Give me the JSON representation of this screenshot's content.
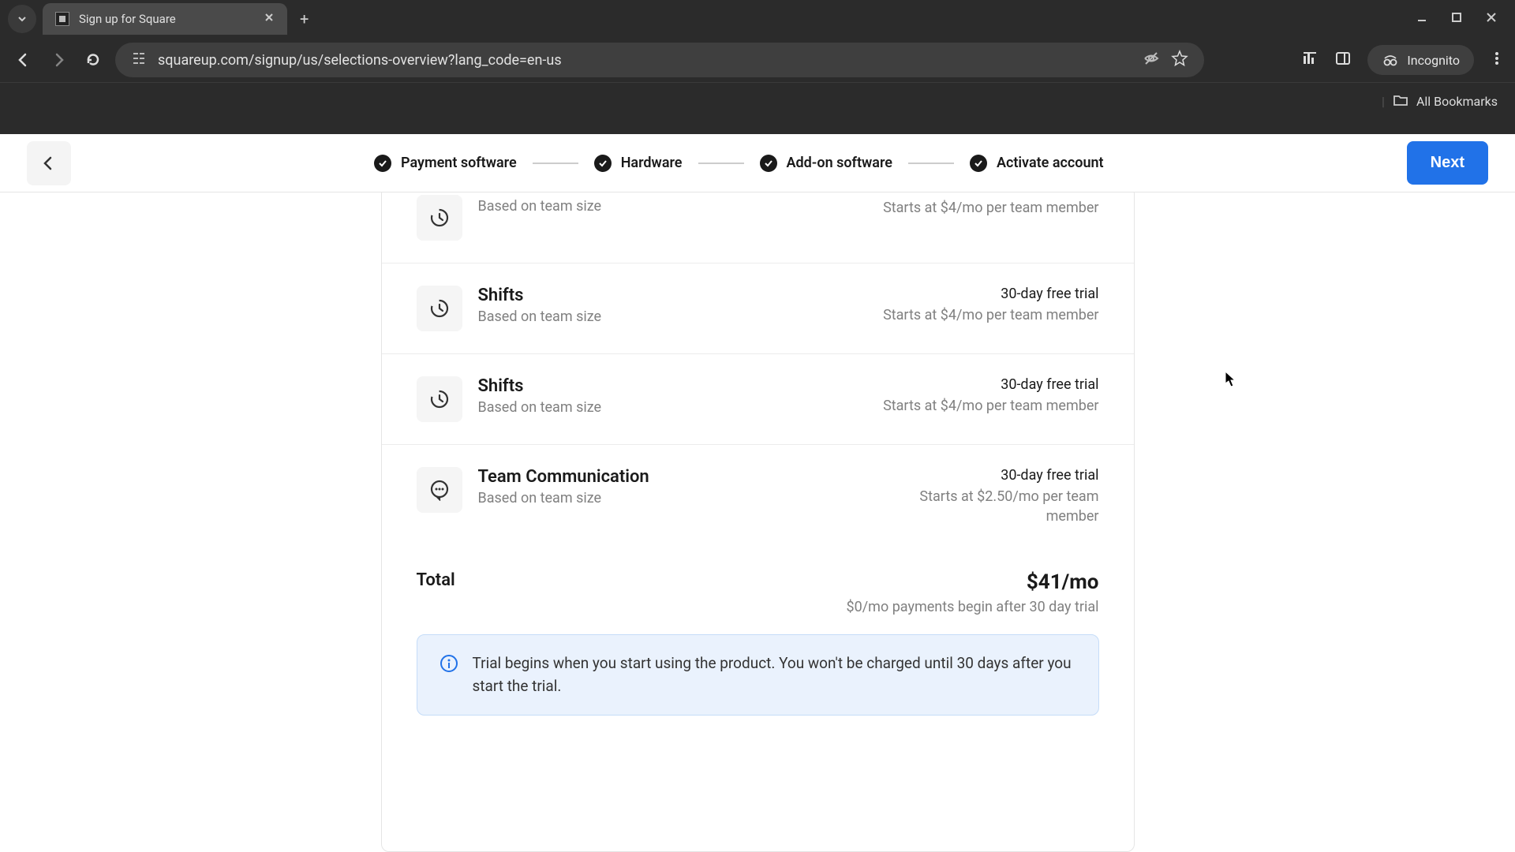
{
  "browser": {
    "tab_title": "Sign up for Square",
    "url": "squareup.com/signup/us/selections-overview?lang_code=en-us",
    "incognito_label": "Incognito",
    "bookmarks_label": "All Bookmarks"
  },
  "header": {
    "steps": [
      "Payment software",
      "Hardware",
      "Add-on software",
      "Activate account"
    ],
    "next_label": "Next"
  },
  "addons": [
    {
      "title": "",
      "subtitle": "Based on team size",
      "trial": "",
      "starts": "Starts at $4/mo per team member",
      "icon": "clock"
    },
    {
      "title": "Shifts",
      "subtitle": "Based on team size",
      "trial": "30-day free trial",
      "starts": "Starts at $4/mo per team member",
      "icon": "clock"
    },
    {
      "title": "Shifts",
      "subtitle": "Based on team size",
      "trial": "30-day free trial",
      "starts": "Starts at $4/mo per team member",
      "icon": "clock"
    },
    {
      "title": "Team Communication",
      "subtitle": "Based on team size",
      "trial": "30-day free trial",
      "starts": "Starts at $2.50/mo per team member",
      "icon": "chat"
    }
  ],
  "total": {
    "label": "Total",
    "amount": "$41/mo",
    "sub": "$0/mo payments begin after 30 day trial"
  },
  "banner": {
    "text": "Trial begins when you start using the product. You won't be charged until 30 days after you start the trial."
  }
}
